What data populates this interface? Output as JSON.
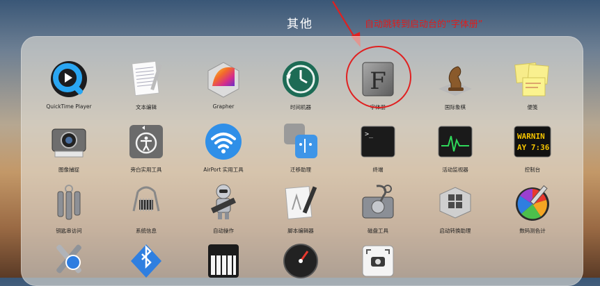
{
  "folder": {
    "title": "其他"
  },
  "annotation": {
    "text": "自动跳转到启动台的“字体册”"
  },
  "colors": {
    "annotation": "#e01c1c",
    "highlight": "#e02020"
  },
  "apps": [
    {
      "label": "QuickTime Player",
      "icon": "quicktime-icon"
    },
    {
      "label": "文本编辑",
      "icon": "textedit-icon"
    },
    {
      "label": "Grapher",
      "icon": "grapher-icon"
    },
    {
      "label": "时间机器",
      "icon": "time-machine-icon"
    },
    {
      "label": "字体册",
      "icon": "font-book-icon"
    },
    {
      "label": "国际象棋",
      "icon": "chess-icon"
    },
    {
      "label": "便笺",
      "icon": "stickies-icon"
    },
    {
      "label": "图像捕捉",
      "icon": "image-capture-icon"
    },
    {
      "label": "旁白实用工具",
      "icon": "voiceover-utility-icon"
    },
    {
      "label": "AirPort 实用工具",
      "icon": "airport-utility-icon"
    },
    {
      "label": "迁移助理",
      "icon": "migration-assistant-icon"
    },
    {
      "label": "终端",
      "icon": "terminal-icon"
    },
    {
      "label": "活动监视器",
      "icon": "activity-monitor-icon"
    },
    {
      "label": "控制台",
      "icon": "console-icon"
    },
    {
      "label": "钥匙串访问",
      "icon": "keychain-icon"
    },
    {
      "label": "系统信息",
      "icon": "system-information-icon"
    },
    {
      "label": "自动操作",
      "icon": "automator-icon"
    },
    {
      "label": "脚本编辑器",
      "icon": "script-editor-icon"
    },
    {
      "label": "磁盘工具",
      "icon": "disk-utility-icon"
    },
    {
      "label": "启动转换助理",
      "icon": "boot-camp-icon"
    },
    {
      "label": "数码测色计",
      "icon": "color-meter-icon"
    },
    {
      "label": "",
      "icon": "utilities-icon"
    },
    {
      "label": "",
      "icon": "bluetooth-icon"
    },
    {
      "label": "",
      "icon": "piano-icon"
    },
    {
      "label": "",
      "icon": "dashboard-icon"
    },
    {
      "label": "",
      "icon": "screenshot-icon"
    }
  ],
  "console_text": {
    "line1": "WARNIN",
    "line2": "AY 7:36"
  },
  "terminal_prompt": ">_",
  "font_book_letter": "F"
}
